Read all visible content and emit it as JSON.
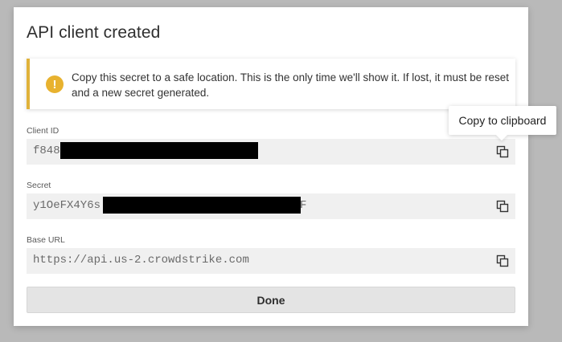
{
  "modal": {
    "title": "API client created",
    "alert": {
      "icon": "warning-icon",
      "color": "#e0b23a",
      "message": "Copy this secret to a safe location. This is the only time we'll show it. If lost, it must be reset and a new secret generated."
    },
    "fields": [
      {
        "label": "Client ID",
        "value_visible": "f848",
        "redacted": true
      },
      {
        "label": "Secret",
        "value_visible": "y1OeFX4Y6s",
        "value_tail": "F",
        "redacted": true
      },
      {
        "label": "Base URL",
        "value_visible": "https://api.us-2.crowdstrike.com",
        "redacted": false
      }
    ],
    "copy_icon": "copy-icon",
    "done_label": "Done"
  },
  "tooltip": {
    "text": "Copy to clipboard"
  }
}
